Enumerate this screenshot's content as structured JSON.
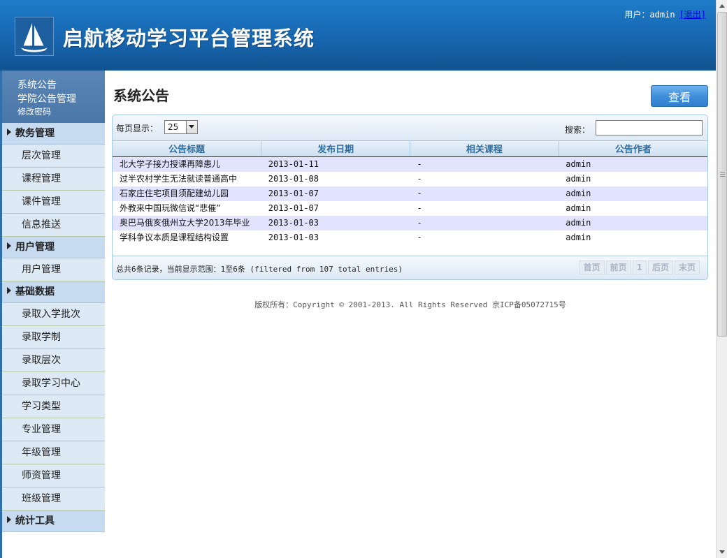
{
  "header": {
    "title": "启航移动学习平台管理系统",
    "user_label": "用户：admin",
    "logout_label": "[退出]"
  },
  "sidebar": {
    "top_links": [
      {
        "label": "系统公告"
      },
      {
        "label": "学院公告管理"
      },
      {
        "label": "修改密码"
      }
    ],
    "groups": [
      {
        "label": "教务管理",
        "items": [
          "层次管理",
          "课程管理",
          "课件管理",
          "信息推送"
        ]
      },
      {
        "label": "用户管理",
        "items": [
          "用户管理"
        ]
      },
      {
        "label": "基础数据",
        "items": [
          "录取入学批次",
          "录取学制",
          "录取层次",
          "录取学习中心",
          "学习类型",
          "专业管理",
          "年级管理",
          "师资管理",
          "班级管理"
        ]
      },
      {
        "label": "统计工具",
        "items": []
      }
    ]
  },
  "main": {
    "page_title": "系统公告",
    "view_button": "查看",
    "toolbar": {
      "per_page_label": "每页显示：",
      "per_page_value": "25",
      "search_label": "搜索：",
      "search_value": ""
    },
    "table": {
      "columns": [
        "公告标题",
        "发布日期",
        "相关课程",
        "公告作者"
      ],
      "rows": [
        [
          "北大学子接力授课再障患儿",
          "2013-01-11",
          "-",
          "admin"
        ],
        [
          "过半农村学生无法就读普通高中",
          "2013-01-08",
          "-",
          "admin"
        ],
        [
          "石家庄住宅项目须配建幼儿园",
          "2013-01-07",
          "-",
          "admin"
        ],
        [
          "外教来中国玩微信说“悲催”",
          "2013-01-07",
          "-",
          "admin"
        ],
        [
          "奥巴马俄亥俄州立大学2013年毕业",
          "2013-01-03",
          "-",
          "admin"
        ],
        [
          "学科争议本质是课程结构设置",
          "2013-01-03",
          "-",
          "admin"
        ]
      ]
    },
    "footer": {
      "record_info": "总共6条记录，当前显示范围：1至6条 (filtered from 107 total entries)",
      "pager": [
        "首页",
        "前页",
        "1",
        "后页",
        "末页"
      ]
    },
    "copyright": "版权所有：Copyright © 2001-2013. All Rights Reserved 京ICP备05072715号"
  },
  "colors": {
    "header_blue": "#1766b0",
    "group_bg": "#c6daf0",
    "item_bg": "#ddeaf6",
    "odd_row": "#e2e4ff",
    "button_blue": "#3f8fdb"
  },
  "icons": [
    "sailboat-logo-icon",
    "triangle-right-icon",
    "chevron-down-icon"
  ]
}
